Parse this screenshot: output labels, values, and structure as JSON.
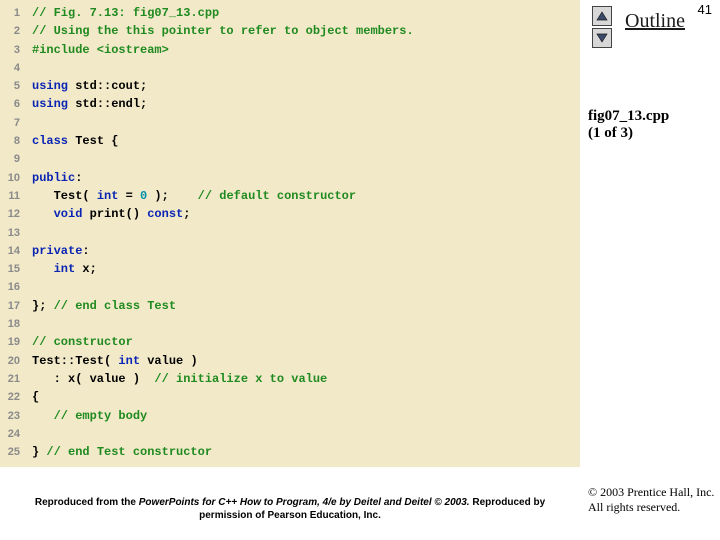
{
  "page_number": "41",
  "sidebar": {
    "outline": "Outline",
    "filename": "fig07_13.cpp",
    "part": "(1 of 3)",
    "copyright_line1": "© 2003 Prentice Hall, Inc.",
    "copyright_line2": "All rights reserved."
  },
  "footer": {
    "prefix": "Reproduced from the ",
    "italic": "PowerPoints for C++ How to Program, 4/e by Deitel and Deitel © 2003. ",
    "suffix": "Reproduced by permission of Pearson Education, Inc."
  },
  "code": [
    {
      "n": "1",
      "segs": [
        {
          "cls": "comment",
          "t": "// Fig. 7.13: fig07_13.cpp"
        }
      ]
    },
    {
      "n": "2",
      "segs": [
        {
          "cls": "comment",
          "t": "// Using the this pointer to refer to object members."
        }
      ]
    },
    {
      "n": "3",
      "segs": [
        {
          "cls": "preproc",
          "t": "#include <iostream>"
        }
      ]
    },
    {
      "n": "4",
      "segs": [
        {
          "cls": "plain",
          "t": ""
        }
      ]
    },
    {
      "n": "5",
      "segs": [
        {
          "cls": "keyword",
          "t": "using "
        },
        {
          "cls": "plain",
          "t": "std::cout;"
        }
      ]
    },
    {
      "n": "6",
      "segs": [
        {
          "cls": "keyword",
          "t": "using "
        },
        {
          "cls": "plain",
          "t": "std::endl;"
        }
      ]
    },
    {
      "n": "7",
      "segs": [
        {
          "cls": "plain",
          "t": ""
        }
      ]
    },
    {
      "n": "8",
      "segs": [
        {
          "cls": "keyword",
          "t": "class "
        },
        {
          "cls": "plain",
          "t": "Test {"
        }
      ]
    },
    {
      "n": "9",
      "segs": [
        {
          "cls": "plain",
          "t": ""
        }
      ]
    },
    {
      "n": "10",
      "segs": [
        {
          "cls": "keyword",
          "t": "public"
        },
        {
          "cls": "plain",
          "t": ":"
        }
      ]
    },
    {
      "n": "11",
      "segs": [
        {
          "cls": "plain",
          "t": "   Test( "
        },
        {
          "cls": "keyword",
          "t": "int"
        },
        {
          "cls": "plain",
          "t": " = "
        },
        {
          "cls": "number",
          "t": "0"
        },
        {
          "cls": "plain",
          "t": " );    "
        },
        {
          "cls": "comment",
          "t": "// default constructor"
        }
      ]
    },
    {
      "n": "12",
      "segs": [
        {
          "cls": "plain",
          "t": "   "
        },
        {
          "cls": "keyword",
          "t": "void "
        },
        {
          "cls": "plain",
          "t": "print() "
        },
        {
          "cls": "keyword",
          "t": "const"
        },
        {
          "cls": "plain",
          "t": ";"
        }
      ]
    },
    {
      "n": "13",
      "segs": [
        {
          "cls": "plain",
          "t": ""
        }
      ]
    },
    {
      "n": "14",
      "segs": [
        {
          "cls": "keyword",
          "t": "private"
        },
        {
          "cls": "plain",
          "t": ":"
        }
      ]
    },
    {
      "n": "15",
      "segs": [
        {
          "cls": "plain",
          "t": "   "
        },
        {
          "cls": "keyword",
          "t": "int "
        },
        {
          "cls": "plain",
          "t": "x;"
        }
      ]
    },
    {
      "n": "16",
      "segs": [
        {
          "cls": "plain",
          "t": ""
        }
      ]
    },
    {
      "n": "17",
      "segs": [
        {
          "cls": "plain",
          "t": "}; "
        },
        {
          "cls": "comment",
          "t": "// end class Test"
        }
      ]
    },
    {
      "n": "18",
      "segs": [
        {
          "cls": "plain",
          "t": ""
        }
      ]
    },
    {
      "n": "19",
      "segs": [
        {
          "cls": "comment",
          "t": "// constructor"
        }
      ]
    },
    {
      "n": "20",
      "segs": [
        {
          "cls": "plain",
          "t": "Test::Test( "
        },
        {
          "cls": "keyword",
          "t": "int "
        },
        {
          "cls": "plain",
          "t": "value )"
        }
      ]
    },
    {
      "n": "21",
      "segs": [
        {
          "cls": "plain",
          "t": "   : x( value )  "
        },
        {
          "cls": "comment",
          "t": "// initialize x to value"
        }
      ]
    },
    {
      "n": "22",
      "segs": [
        {
          "cls": "plain",
          "t": "{"
        }
      ]
    },
    {
      "n": "23",
      "segs": [
        {
          "cls": "plain",
          "t": "   "
        },
        {
          "cls": "comment",
          "t": "// empty body       "
        }
      ]
    },
    {
      "n": "24",
      "segs": [
        {
          "cls": "plain",
          "t": ""
        }
      ]
    },
    {
      "n": "25",
      "segs": [
        {
          "cls": "plain",
          "t": "} "
        },
        {
          "cls": "comment",
          "t": "// end Test constructor"
        }
      ]
    }
  ]
}
